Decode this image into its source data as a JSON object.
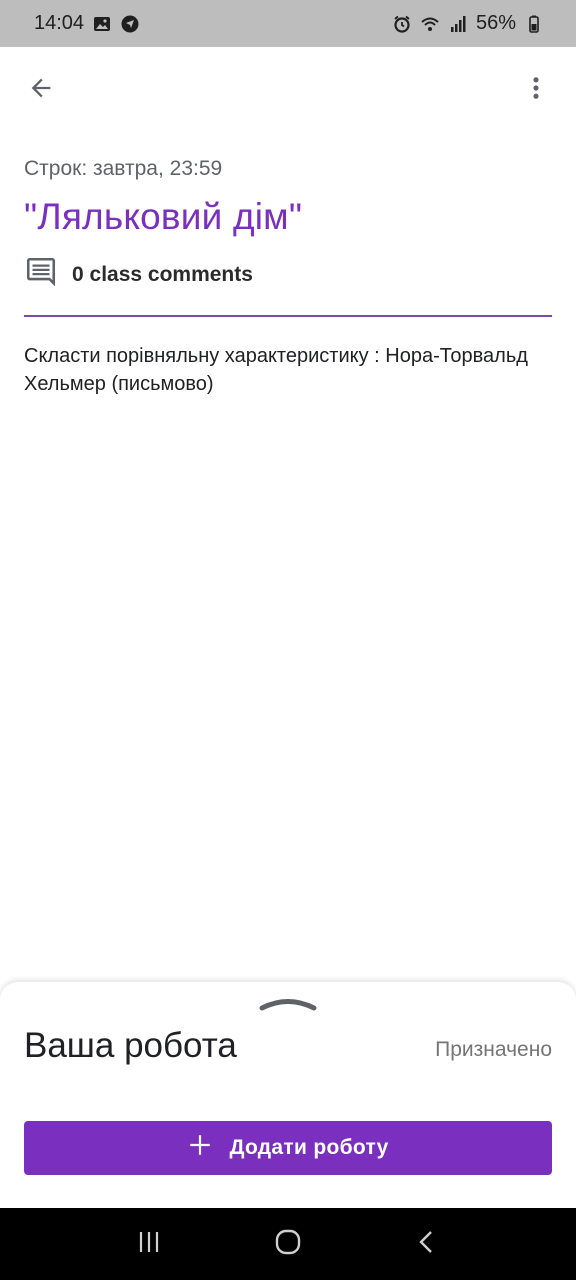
{
  "status_bar": {
    "time": "14:04",
    "battery": "56%",
    "icons": [
      "image-icon",
      "send-icon",
      "alarm-icon",
      "wifi-icon",
      "signal-icon",
      "battery-icon"
    ]
  },
  "app_bar": {
    "back_icon": "arrow-back-icon",
    "more_icon": "more-vertical-icon"
  },
  "assignment": {
    "due": "Строк: завтра, 23:59",
    "title": "\"Ляльковий дім\"",
    "comments_label": "0 class comments",
    "description": "Скласти порівняльну характеристику : Нора-Торвальд Хельмер (письмово)"
  },
  "bottom_sheet": {
    "title": "Ваша робота",
    "status": "Призначено",
    "add_button_label": "Додати роботу"
  },
  "colors": {
    "accent": "#7b2fbe",
    "status_bar": "#bdbdbd",
    "nav_bar": "#000000"
  },
  "nav_bar": {
    "icons": [
      "recents-icon",
      "home-icon",
      "back-nav-icon"
    ]
  }
}
